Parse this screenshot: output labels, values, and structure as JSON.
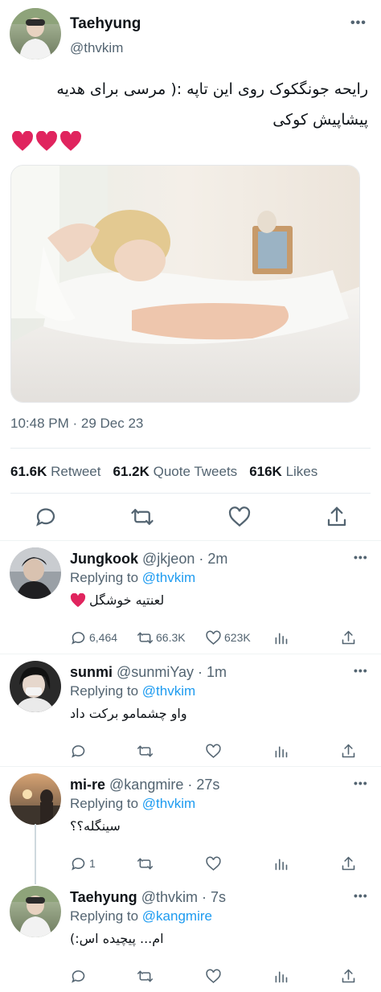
{
  "tweet": {
    "author_name": "Taehyung",
    "author_handle": "@thvkim",
    "text": "رایحه جونگکوک روی این تاپه :( مرسی برای هدیه پیشاپیش کوکی",
    "emoji": "❤️❤️❤️",
    "timestamp": "10:48 PM · 29 Dec 23",
    "stats": [
      {
        "value": "61.6K",
        "label": "Retweet"
      },
      {
        "value": "61.2K",
        "label": "Quote Tweets"
      },
      {
        "value": "616K",
        "label": "Likes"
      }
    ],
    "more_glyph": "•••"
  },
  "replies": [
    {
      "name": "Jungkook",
      "handle": "@jkjeon",
      "time": "· 2m",
      "replying_prefix": "Replying to",
      "replying_to": "@thvkim",
      "text": "لعنتیه خوشگل",
      "has_heart": true,
      "counts": {
        "reply": "6,464",
        "retweet": "66.3K",
        "like": "623K"
      }
    },
    {
      "name": "sunmi",
      "handle": "@sunmiYay",
      "time": "· 1m",
      "replying_prefix": "Replying to",
      "replying_to": "@thvkim",
      "text": "واو چشمامو برکت داد",
      "has_heart": false,
      "counts": {
        "reply": "",
        "retweet": "",
        "like": ""
      }
    },
    {
      "name": "mi-re",
      "handle": "@kangmire",
      "time": "· 27s",
      "replying_prefix": "Replying to",
      "replying_to": "@thvkim",
      "text": "سینگله؟؟",
      "has_heart": false,
      "counts": {
        "reply": "1",
        "retweet": "",
        "like": ""
      }
    },
    {
      "name": "Taehyung",
      "handle": "@thvkim",
      "time": "· 7s",
      "replying_prefix": "Replying to",
      "replying_to": "@kangmire",
      "text": "ام... پیچیده اس:)",
      "has_heart": false,
      "counts": {
        "reply": "",
        "retweet": "",
        "like": ""
      }
    }
  ],
  "colors": {
    "accent": "#1d9bf0",
    "secondary_text": "#536471",
    "heart": "#e0245e"
  },
  "icons": [
    "reply-icon",
    "retweet-icon",
    "like-icon",
    "share-icon",
    "analytics-icon",
    "more-icon",
    "heart-emoji"
  ]
}
